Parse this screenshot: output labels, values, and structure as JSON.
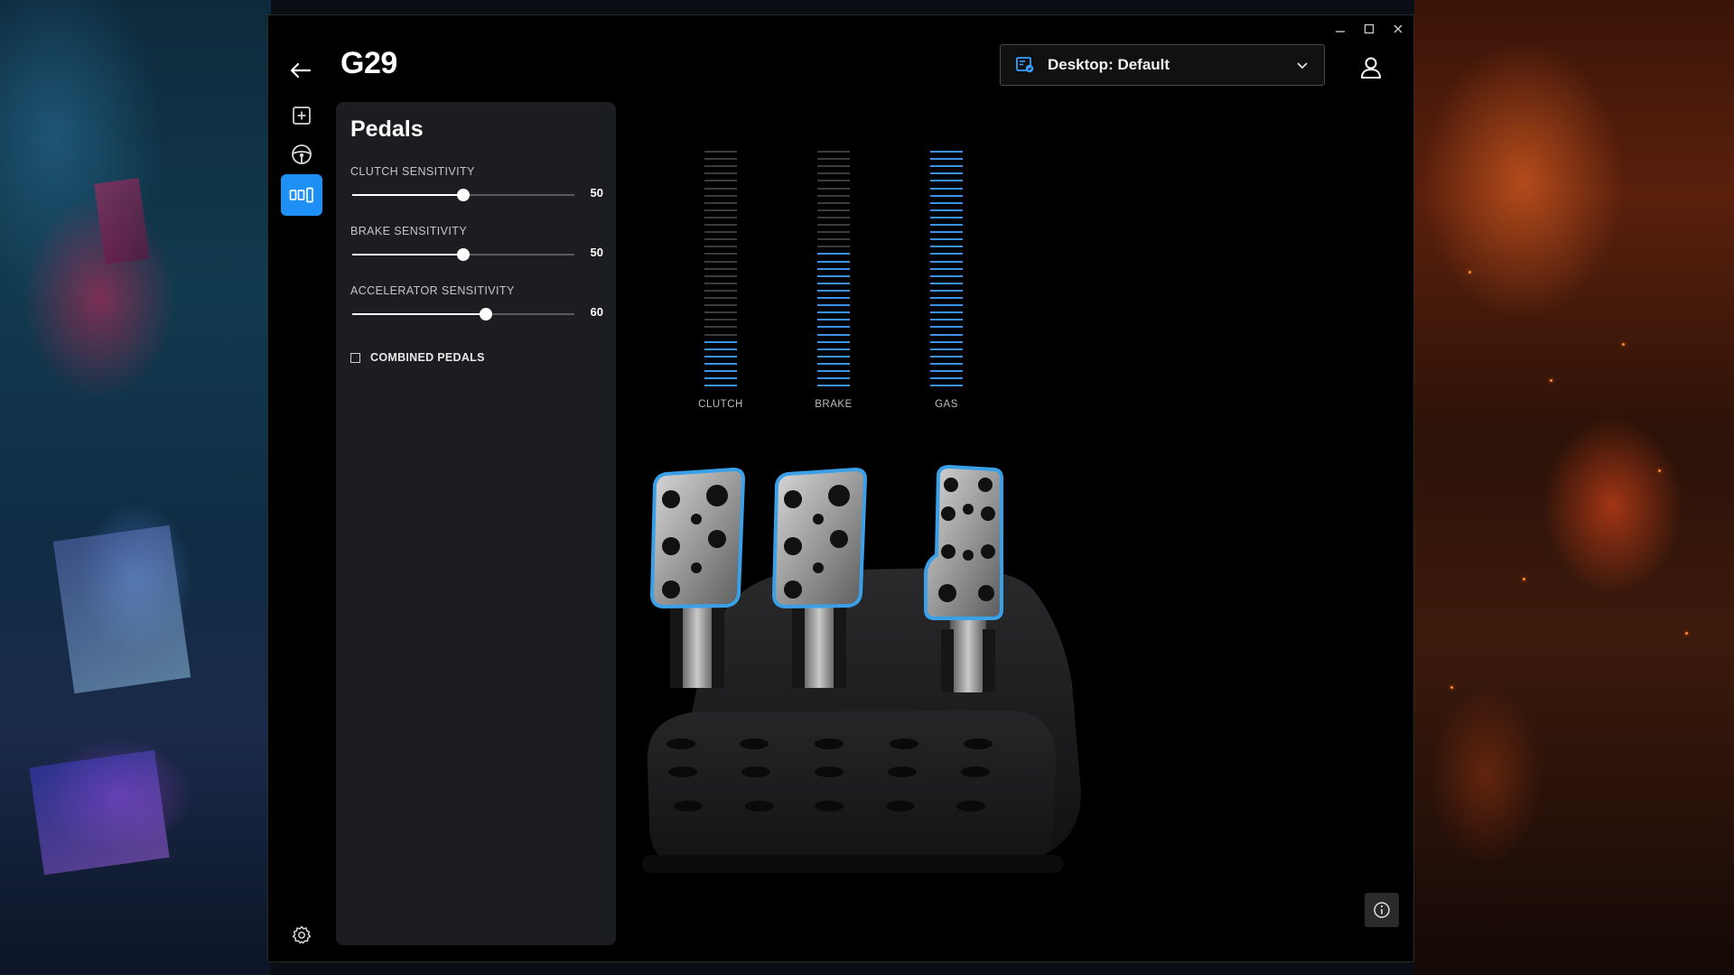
{
  "window": {
    "title": "G29",
    "controls": [
      "minimize-icon",
      "maximize-icon",
      "close-icon"
    ]
  },
  "header": {
    "profile_label": "Desktop: Default"
  },
  "rail": {
    "items": [
      {
        "name": "add-icon",
        "active": false
      },
      {
        "name": "steering-wheel-icon",
        "active": false
      },
      {
        "name": "pedals-icon",
        "active": true
      }
    ],
    "bottom": "gear-icon"
  },
  "panel": {
    "title": "Pedals",
    "sliders": [
      {
        "label": "CLUTCH SENSITIVITY",
        "value": "50",
        "fraction": 0.5
      },
      {
        "label": "BRAKE SENSITIVITY",
        "value": "50",
        "fraction": 0.5
      },
      {
        "label": "ACCELERATOR SENSITIVITY",
        "value": "60",
        "fraction": 0.6
      }
    ],
    "combined_pedals": {
      "label": "COMBINED PEDALS",
      "checked": false
    }
  },
  "pedals": [
    {
      "label": "CLUTCH",
      "level": 0.21
    },
    {
      "label": "BRAKE",
      "level": 0.58
    },
    {
      "label": "GAS",
      "level": 1.0
    }
  ],
  "colors": {
    "accent": "#1d8ff5",
    "meter_on": "#3a93e6",
    "meter_off": "#3c3c3c",
    "pedal_outline": "#3aa0e8"
  }
}
